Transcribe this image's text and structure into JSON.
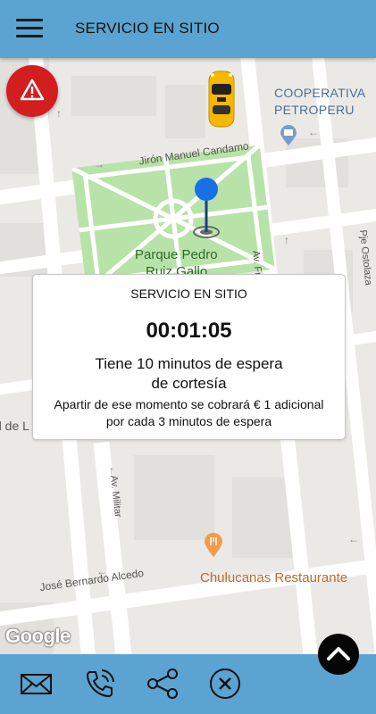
{
  "header": {
    "title": "SERVICIO EN SITIO",
    "menu_icon": "hamburger-menu-icon"
  },
  "map": {
    "street_labels": {
      "jiron_manuel_candamo": "Jirón Manuel Candamo",
      "av_francisco": "Av. Francisco",
      "pje_ostolaza": "Pje Ostolaza",
      "av_militar": "Av. Militar",
      "jose_bernardo_alcedo": "José Bernardo Alcedo",
      "de_l": "d de L"
    },
    "poi_labels": {
      "cooperativa_line1": "COOPERATIVA",
      "cooperativa_line2": "PETROPERU",
      "park_line1": "Parque Pedro",
      "park_line2": "Ruiz Gallo",
      "restaurant": "Chulucanas Restaurante"
    },
    "attribution": "Google",
    "colors": {
      "park": "#b8e3a8",
      "restaurant_text": "#c0692a",
      "cooperativa_text": "#4a6f9a",
      "pin": "#1a6fe6"
    }
  },
  "alert": {
    "icon": "warning-triangle-icon",
    "color": "#d21e1e"
  },
  "dialog": {
    "title": "SERVICIO EN SITIO",
    "timer": "00:01:05",
    "message": "Tiene 10 minutos de espera de cortesía",
    "note": "Apartir de ese momento se cobrará € 1 adicional por cada 3 minutos de espera"
  },
  "footer": {
    "buttons": [
      {
        "icon": "mail-icon"
      },
      {
        "icon": "phone-icon"
      },
      {
        "icon": "share-icon"
      },
      {
        "icon": "cancel-circle-icon"
      }
    ],
    "scroll_up_icon": "chevron-up-icon"
  }
}
